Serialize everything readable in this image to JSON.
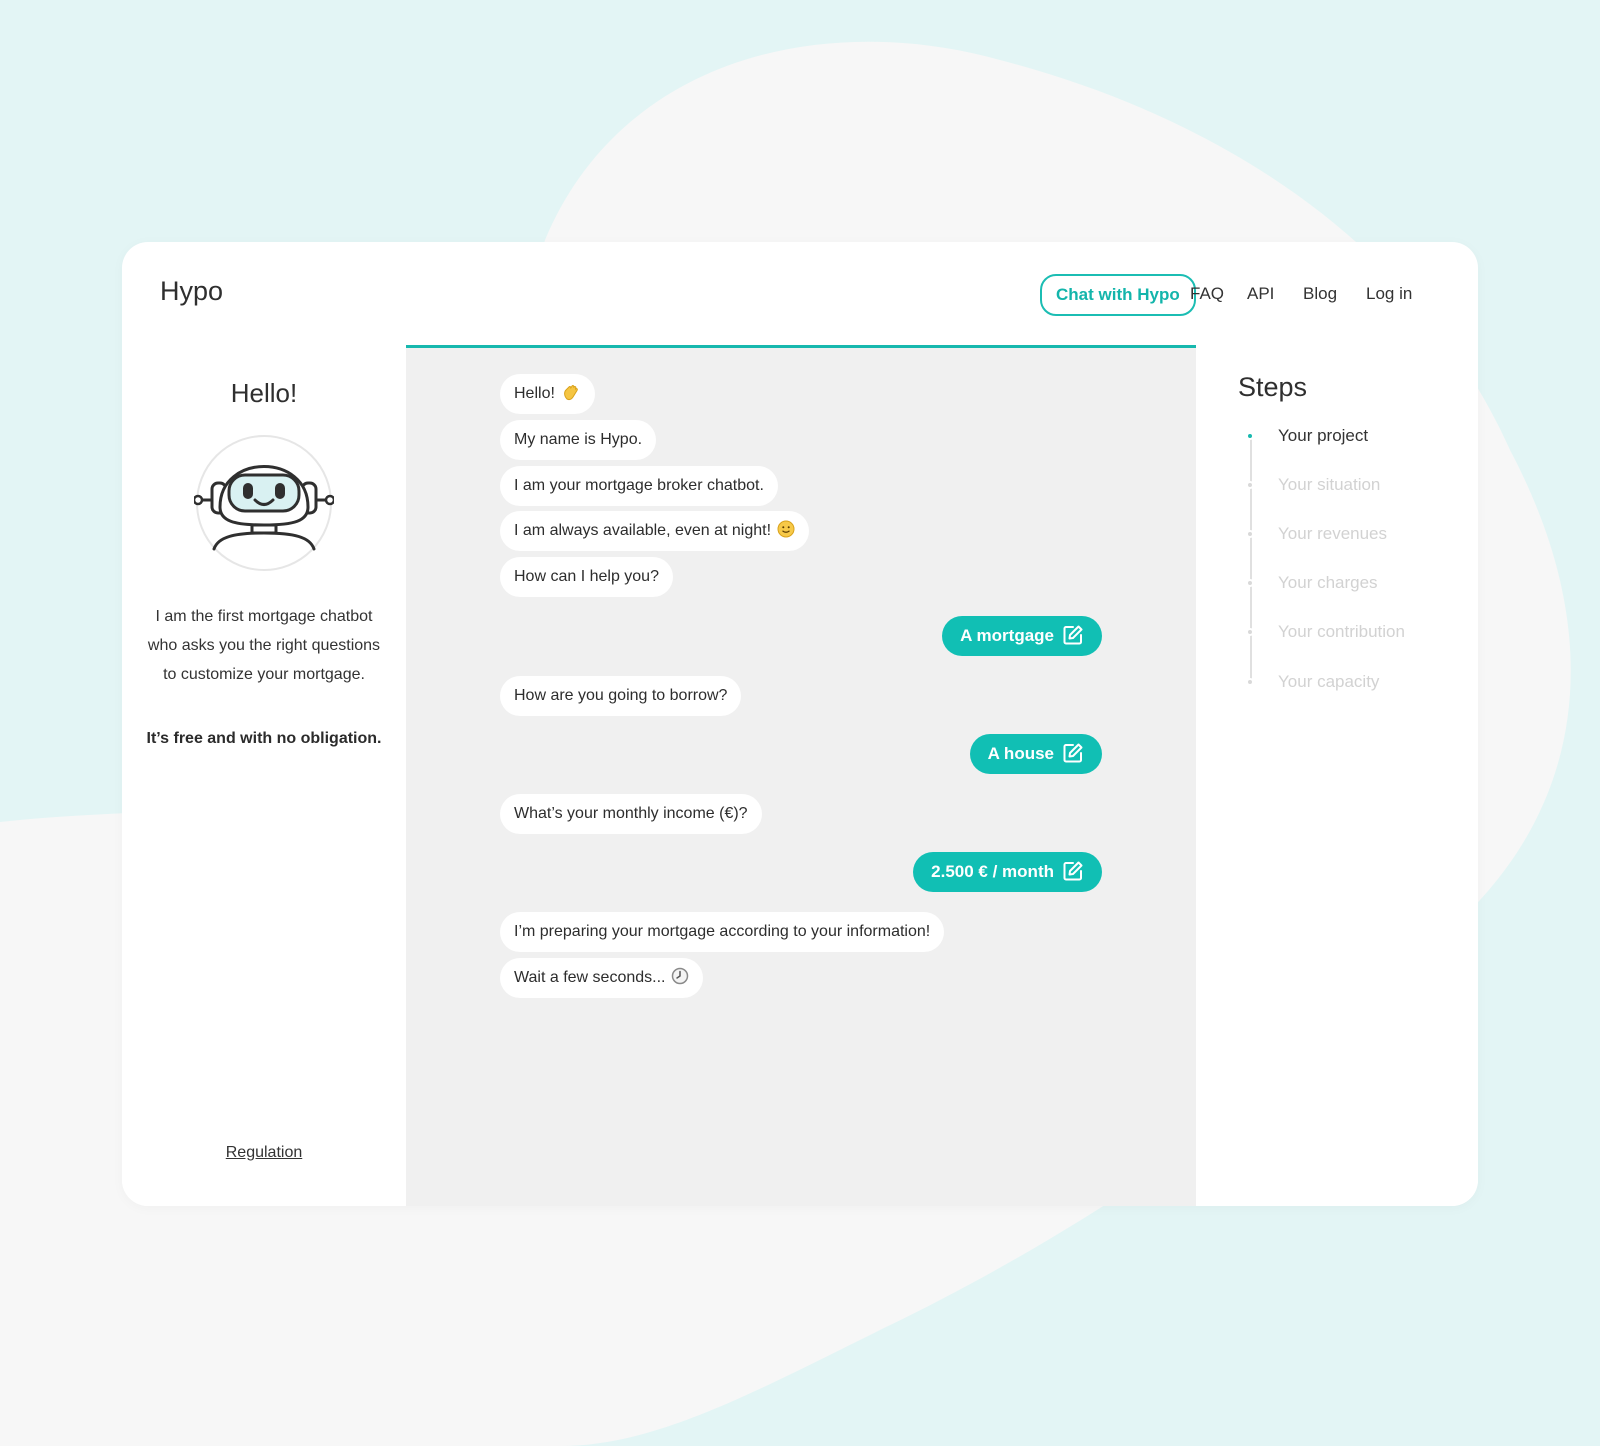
{
  "colors": {
    "accent": "#11bfb4",
    "page_bg": "#e3f5f5",
    "chat_bg": "#f0f0f0"
  },
  "header": {
    "brand": "Hypo",
    "nav": {
      "chat_button": "Chat with Hypo",
      "faq": "FAQ",
      "api": "API",
      "blog": "Blog",
      "login": "Log in"
    }
  },
  "left": {
    "greeting": "Hello!",
    "avatar_icon": "robot-icon",
    "intro": "I am the first mortgage chatbot who asks you the right questions to customize your mortgage.",
    "free_note": "It’s free and with no obligation.",
    "regulation_link": "Regulation"
  },
  "chat": {
    "messages": [
      {
        "text": "Hello!",
        "emoji": "waving-hand-icon"
      },
      {
        "text": "My name is Hypo."
      },
      {
        "text": "I am your mortgage broker chatbot."
      },
      {
        "text": "I am always available, even at night!",
        "emoji": "smiley-icon"
      },
      {
        "text": "How can I help you?"
      },
      {
        "reply": "A mortgage",
        "icon": "edit-icon"
      },
      {
        "text": "How are you going to borrow?"
      },
      {
        "reply": "A house",
        "icon": "edit-icon"
      },
      {
        "text": "What’s your monthly income (€)?"
      },
      {
        "reply": "2.500 € / month",
        "icon": "edit-icon"
      },
      {
        "text": "I’m preparing your mortgage according to your information!"
      },
      {
        "text": "Wait a few seconds...",
        "emoji": "clock-icon"
      }
    ]
  },
  "steps": {
    "title": "Steps",
    "items": [
      {
        "label": "Your project",
        "active": true
      },
      {
        "label": "Your situation",
        "active": false
      },
      {
        "label": "Your revenues",
        "active": false
      },
      {
        "label": "Your charges",
        "active": false
      },
      {
        "label": "Your contribution",
        "active": false
      },
      {
        "label": "Your capacity",
        "active": false
      }
    ]
  }
}
